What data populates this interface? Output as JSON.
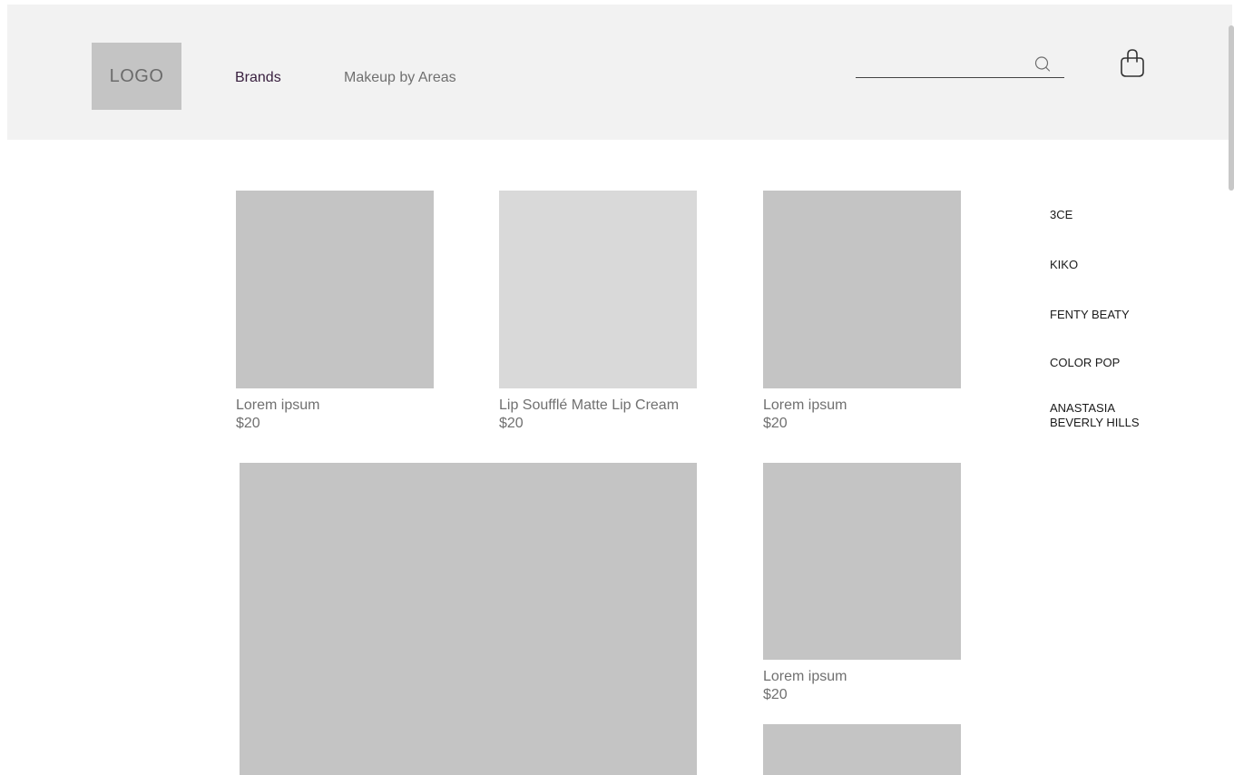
{
  "header": {
    "logo_text": "LOGO",
    "nav": [
      {
        "label": "Brands"
      },
      {
        "label": "Makeup by Areas"
      }
    ],
    "search": {
      "value": "",
      "placeholder": ""
    }
  },
  "products": [
    {
      "name": "Lorem ipsum",
      "price": "$20"
    },
    {
      "name": "Lip Soufflé Matte Lip Cream",
      "price": "$20"
    },
    {
      "name": "Lorem ipsum",
      "price": "$20"
    },
    {
      "name": "Lorem ipsum",
      "price": "$20"
    }
  ],
  "brands": [
    {
      "label": "3CE"
    },
    {
      "label": "KIKO"
    },
    {
      "label": "FENTY BEATY"
    },
    {
      "label": "COLOR POP"
    },
    {
      "label": "ANASTASIA BEVERLY HILLS"
    }
  ],
  "icons": {
    "search": "search-icon",
    "cart": "shopping-bag-icon"
  },
  "colors": {
    "header_bg": "#f2f2f2",
    "placeholder_gray": "#c4c4c4",
    "placeholder_light": "#d9d9d9",
    "active_nav": "#3a2140"
  }
}
